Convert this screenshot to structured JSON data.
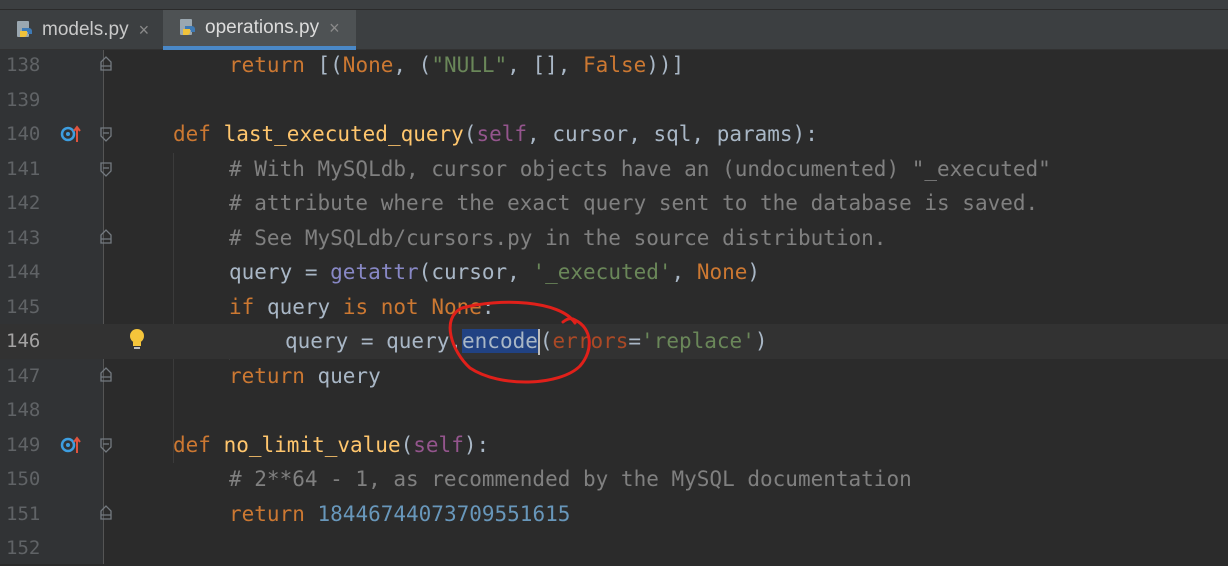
{
  "tabs": [
    {
      "label": "models.py",
      "active": false,
      "icon": "python-file-icon"
    },
    {
      "label": "operations.py",
      "active": true,
      "icon": "python-file-icon"
    }
  ],
  "tab_close_glyph": "×",
  "colors": {
    "background": "#2b2b2b",
    "keyword": "#cc7832",
    "function": "#ffc66d",
    "string": "#6a8759",
    "comment": "#808080",
    "number": "#6897bb",
    "selection": "#214283",
    "annotation": "#e0201a"
  },
  "lines": [
    {
      "num": "138",
      "t": [
        "return",
        " [(",
        "None",
        ", (",
        "\"NULL\"",
        ", [], ",
        "False",
        "))]"
      ]
    },
    {
      "num": "139"
    },
    {
      "num": "140",
      "t": [
        "def",
        " ",
        "last_executed_query",
        "(",
        "self",
        ", cursor, sql, params):"
      ]
    },
    {
      "num": "141",
      "t": [
        "# With MySQLdb, cursor objects have an (undocumented) \"_executed\""
      ]
    },
    {
      "num": "142",
      "t": [
        "# attribute where the exact query sent to the database is saved."
      ]
    },
    {
      "num": "143",
      "t": [
        "# See MySQLdb/cursors.py in the source distribution."
      ]
    },
    {
      "num": "144",
      "t": [
        "query = ",
        "getattr",
        "(cursor, ",
        "'_executed'",
        ", ",
        "None",
        ")"
      ]
    },
    {
      "num": "145",
      "t": [
        "if",
        " query ",
        "is not",
        " ",
        "None",
        ":"
      ]
    },
    {
      "num": "146",
      "t": [
        "query = query.",
        "encode",
        "(",
        "errors",
        "=",
        "'replace'",
        ")"
      ]
    },
    {
      "num": "147",
      "t": [
        "return",
        " query"
      ]
    },
    {
      "num": "148"
    },
    {
      "num": "149",
      "t": [
        "def",
        " ",
        "no_limit_value",
        "(",
        "self",
        "):"
      ]
    },
    {
      "num": "150",
      "t": [
        "# 2**64 - 1, as recommended by the MySQL documentation"
      ]
    },
    {
      "num": "151",
      "t": [
        "return",
        " ",
        "18446744073709551615"
      ]
    },
    {
      "num": "152"
    }
  ]
}
